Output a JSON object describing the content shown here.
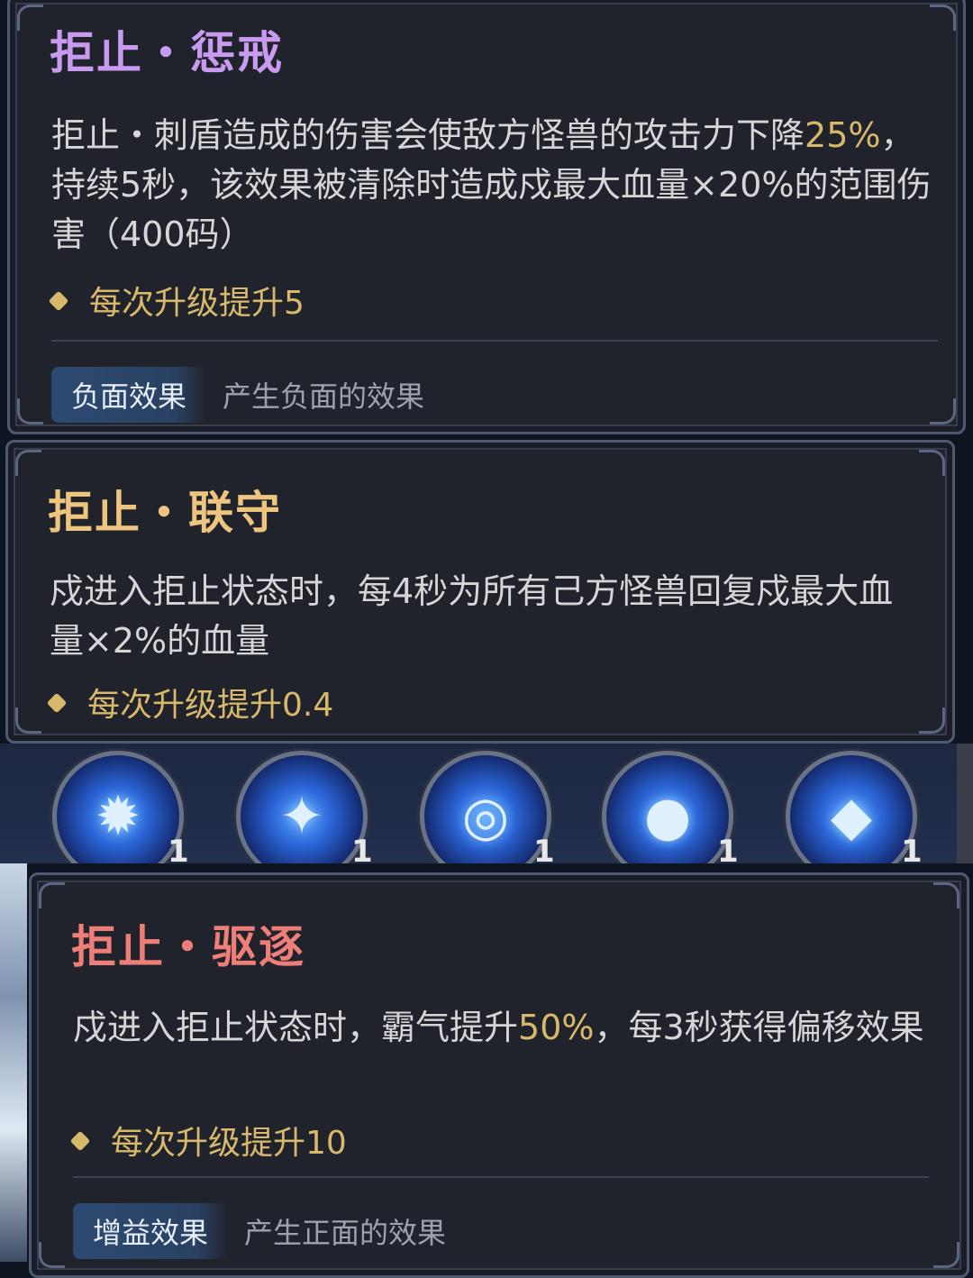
{
  "cards": [
    {
      "title": "拒止・惩戒",
      "title_color": "#c99bf0",
      "desc_parts": [
        "拒止・刺盾造成的伤害会使敌方怪兽的攻击力下降",
        "25%",
        "，持续5秒，该效果被清除时造成戍最大血量×20%的范围伤害（400码）"
      ],
      "bullet": "每次升级提升5",
      "tag": "负面效果",
      "tag_desc": "产生负面的效果"
    },
    {
      "title": "拒止・联守",
      "title_color": "#eec57e",
      "desc": "戍进入拒止状态时，每4秒为所有己方怪兽回复戍最大血量×2%的血量",
      "bullet": "每次升级提升0.4"
    },
    {
      "title": "拒止・驱逐",
      "title_color": "#ee7e78",
      "desc_parts": [
        "戍进入拒止状态时，霸气提升",
        "50%",
        "，每3秒获得偏移效果"
      ],
      "bullet": "每次升级提升10",
      "tag": "增益效果",
      "tag_desc": "产生正面的效果"
    }
  ],
  "skills": [
    {
      "icon": "dragon-icon",
      "level": "1"
    },
    {
      "icon": "star-burst-icon",
      "level": "1"
    },
    {
      "icon": "vortex-icon",
      "level": "1"
    },
    {
      "icon": "orb-icon",
      "level": "1"
    },
    {
      "icon": "crystal-icon",
      "level": "1"
    }
  ]
}
